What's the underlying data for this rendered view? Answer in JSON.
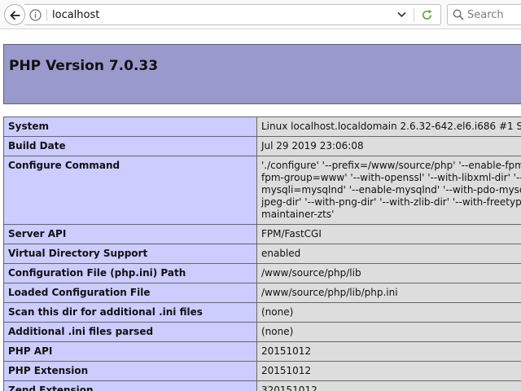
{
  "browser": {
    "url": "localhost",
    "search_placeholder": "Search"
  },
  "page": {
    "title": "PHP Version 7.0.33"
  },
  "info_rows": [
    {
      "key": "System",
      "value": "Linux localhost.localdomain 2.6.32-642.el6.i686 #1 S"
    },
    {
      "key": "Build Date",
      "value": "Jul 29 2019 23:06:08"
    },
    {
      "key": "Configure Command",
      "lines": [
        "'./configure' '--prefix=/www/source/php' '--enable-fpm",
        "fpm-group=www' '--with-openssl' '--with-libxml-dir' '--",
        "mysqli=mysqlnd' '--enable-mysqlnd' '--with-pdo-mysq",
        "jpeg-dir' '--with-png-dir' '--with-zlib-dir' '--with-freetype",
        "maintainer-zts'"
      ]
    },
    {
      "key": "Server API",
      "value": "FPM/FastCGI"
    },
    {
      "key": "Virtual Directory Support",
      "value": "enabled"
    },
    {
      "key": "Configuration File (php.ini) Path",
      "value": "/www/source/php/lib"
    },
    {
      "key": "Loaded Configuration File",
      "value": "/www/source/php/lib/php.ini"
    },
    {
      "key": "Scan this dir for additional .ini files",
      "value": "(none)"
    },
    {
      "key": "Additional .ini files parsed",
      "value": "(none)"
    },
    {
      "key": "PHP API",
      "value": "20151012"
    },
    {
      "key": "PHP Extension",
      "value": "20151012"
    },
    {
      "key": "Zend Extension",
      "value": "320151012"
    }
  ]
}
